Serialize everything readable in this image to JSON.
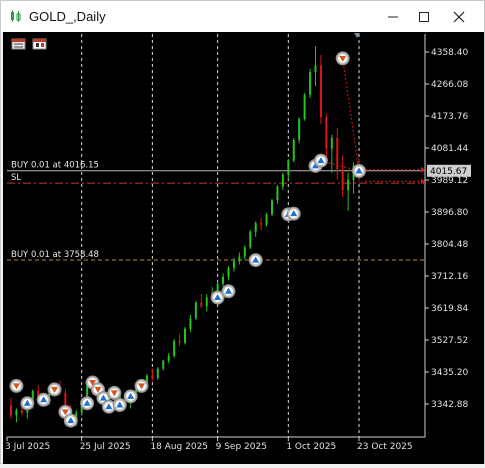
{
  "window": {
    "title": "GOLD_,Daily"
  },
  "toolbar_icons": [
    "object-list-icon",
    "calendar-icon"
  ],
  "chart_data": {
    "type": "candlestick",
    "symbol": "GOLD",
    "timeframe": "Daily",
    "y_ticks": [
      4358.4,
      4266.08,
      4173.76,
      4081.44,
      3989.12,
      3896.8,
      3804.48,
      3712.16,
      3619.84,
      3527.52,
      3435.2,
      3342.88
    ],
    "y_tick_labels": [
      "4358.40",
      "4266.08",
      "4173.76",
      "4081.44",
      "3989.12",
      "3896.80",
      "3804.48",
      "3712.16",
      "3619.84",
      "3527.52",
      "3435.20",
      "3342.88"
    ],
    "x_labels": [
      "3 Jul 2025",
      "25 Jul 2025",
      "18 Aug 2025",
      "9 Sep 2025",
      "1 Oct 2025",
      "23 Oct 2025"
    ],
    "current_price": "4015.67",
    "current_price_value": 4015.67,
    "position_lines": [
      {
        "label": "BUY 0.01 at 4016.15",
        "price": 4016.15,
        "color": "#7a7a7a"
      },
      {
        "label": "SL",
        "price": 3980.0,
        "color": "#c43b2a"
      },
      {
        "label": "BUY 0.01 at 3758.48",
        "price": 3758.48,
        "color": "#c0852a"
      }
    ],
    "colors": {
      "bull": "#27c41a",
      "bear": "#e01515",
      "grid": "#ffffff",
      "axis_text": "#e0e0e0",
      "background": "#000000"
    },
    "ohlc": [
      [
        3340,
        3360,
        3300,
        3310
      ],
      [
        3310,
        3330,
        3290,
        3325
      ],
      [
        3325,
        3345,
        3310,
        3318
      ],
      [
        3318,
        3350,
        3300,
        3340
      ],
      [
        3340,
        3385,
        3330,
        3380
      ],
      [
        3380,
        3398,
        3355,
        3360
      ],
      [
        3360,
        3375,
        3335,
        3345
      ],
      [
        3345,
        3380,
        3340,
        3372
      ],
      [
        3372,
        3400,
        3365,
        3390
      ],
      [
        3390,
        3410,
        3370,
        3375
      ],
      [
        3375,
        3385,
        3320,
        3330
      ],
      [
        3330,
        3340,
        3290,
        3300
      ],
      [
        3300,
        3325,
        3280,
        3318
      ],
      [
        3318,
        3360,
        3310,
        3355
      ],
      [
        3355,
        3400,
        3350,
        3395
      ],
      [
        3395,
        3415,
        3370,
        3380
      ],
      [
        3380,
        3400,
        3350,
        3360
      ],
      [
        3360,
        3380,
        3330,
        3340
      ],
      [
        3340,
        3370,
        3325,
        3365
      ],
      [
        3365,
        3395,
        3345,
        3350
      ],
      [
        3350,
        3372,
        3335,
        3368
      ],
      [
        3368,
        3375,
        3340,
        3345
      ],
      [
        3345,
        3362,
        3330,
        3358
      ],
      [
        3358,
        3390,
        3355,
        3385
      ],
      [
        3385,
        3405,
        3378,
        3400
      ],
      [
        3400,
        3430,
        3395,
        3425
      ],
      [
        3425,
        3445,
        3410,
        3418
      ],
      [
        3418,
        3450,
        3412,
        3445
      ],
      [
        3445,
        3470,
        3440,
        3468
      ],
      [
        3468,
        3490,
        3460,
        3482
      ],
      [
        3482,
        3530,
        3475,
        3525
      ],
      [
        3525,
        3545,
        3510,
        3520
      ],
      [
        3520,
        3565,
        3515,
        3560
      ],
      [
        3560,
        3600,
        3550,
        3590
      ],
      [
        3590,
        3640,
        3585,
        3635
      ],
      [
        3635,
        3660,
        3620,
        3625
      ],
      [
        3625,
        3660,
        3610,
        3650
      ],
      [
        3650,
        3680,
        3640,
        3662
      ],
      [
        3662,
        3695,
        3655,
        3690
      ],
      [
        3690,
        3720,
        3680,
        3710
      ],
      [
        3710,
        3740,
        3700,
        3735
      ],
      [
        3735,
        3765,
        3725,
        3755
      ],
      [
        3755,
        3780,
        3745,
        3768
      ],
      [
        3768,
        3800,
        3760,
        3795
      ],
      [
        3795,
        3845,
        3790,
        3840
      ],
      [
        3840,
        3870,
        3825,
        3865
      ],
      [
        3865,
        3880,
        3845,
        3860
      ],
      [
        3860,
        3895,
        3855,
        3890
      ],
      [
        3890,
        3935,
        3885,
        3930
      ],
      [
        3930,
        3975,
        3920,
        3970
      ],
      [
        3970,
        4010,
        3960,
        4005
      ],
      [
        4005,
        4050,
        3990,
        4045
      ],
      [
        4045,
        4110,
        4040,
        4105
      ],
      [
        4105,
        4170,
        4095,
        4165
      ],
      [
        4165,
        4240,
        4160,
        4235
      ],
      [
        4235,
        4310,
        4225,
        4300
      ],
      [
        4300,
        4375,
        4260,
        4320
      ],
      [
        4320,
        4350,
        4150,
        4170
      ],
      [
        4170,
        4180,
        4050,
        4080
      ],
      [
        4080,
        4120,
        4010,
        4110
      ],
      [
        4110,
        4140,
        3990,
        4020
      ],
      [
        4020,
        4060,
        3940,
        3960
      ],
      [
        3960,
        4010,
        3900,
        3990
      ],
      [
        3990,
        4040,
        3950,
        4030
      ],
      [
        4030,
        4050,
        3985,
        4015
      ]
    ],
    "trade_markers": [
      {
        "index": 1,
        "price": 3395,
        "kind": "sell"
      },
      {
        "index": 3,
        "price": 3345,
        "kind": "buy"
      },
      {
        "index": 6,
        "price": 3355,
        "kind": "buy"
      },
      {
        "index": 8,
        "price": 3385,
        "kind": "sell"
      },
      {
        "index": 10,
        "price": 3320,
        "kind": "sell"
      },
      {
        "index": 11,
        "price": 3295,
        "kind": "buy"
      },
      {
        "index": 14,
        "price": 3345,
        "kind": "buy"
      },
      {
        "index": 15,
        "price": 3405,
        "kind": "sell"
      },
      {
        "index": 16,
        "price": 3385,
        "kind": "sell"
      },
      {
        "index": 17,
        "price": 3360,
        "kind": "buy"
      },
      {
        "index": 18,
        "price": 3335,
        "kind": "buy"
      },
      {
        "index": 19,
        "price": 3375,
        "kind": "sell"
      },
      {
        "index": 20,
        "price": 3340,
        "kind": "buy"
      },
      {
        "index": 22,
        "price": 3365,
        "kind": "buy"
      },
      {
        "index": 24,
        "price": 3395,
        "kind": "sell"
      },
      {
        "index": 38,
        "price": 3650,
        "kind": "buy"
      },
      {
        "index": 40,
        "price": 3668,
        "kind": "buy"
      },
      {
        "index": 45,
        "price": 3758,
        "kind": "buy"
      },
      {
        "index": 51,
        "price": 3890,
        "kind": "buy"
      },
      {
        "index": 52,
        "price": 3892,
        "kind": "buy"
      },
      {
        "index": 56,
        "price": 4030,
        "kind": "buy"
      },
      {
        "index": 57,
        "price": 4045,
        "kind": "buy"
      },
      {
        "index": 61,
        "price": 4340,
        "kind": "sell"
      },
      {
        "index": 64,
        "price": 4015,
        "kind": "buy"
      }
    ]
  }
}
